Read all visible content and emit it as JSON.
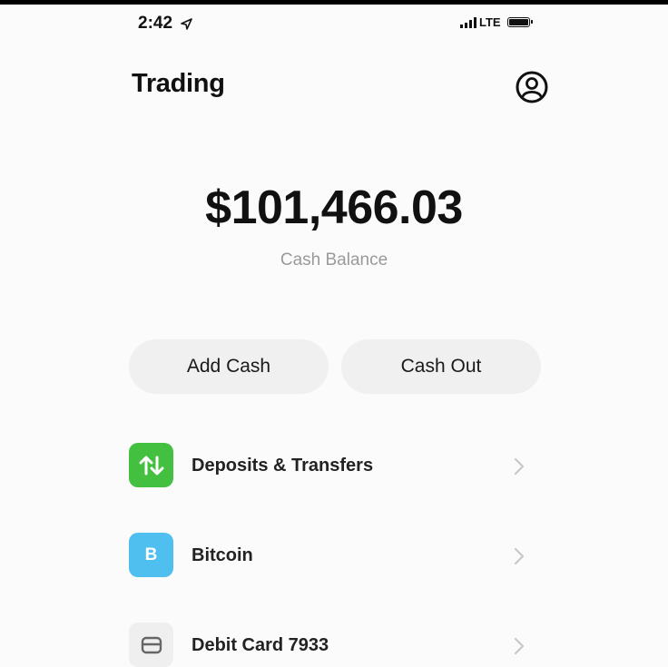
{
  "status_bar": {
    "time": "2:42",
    "network": "LTE"
  },
  "header": {
    "title": "Trading",
    "profile_icon": "profile-icon"
  },
  "balance": {
    "amount": "$101,466.03",
    "label": "Cash Balance"
  },
  "actions": {
    "add_cash_label": "Add Cash",
    "cash_out_label": "Cash Out"
  },
  "menu": {
    "items": [
      {
        "label": "Deposits & Transfers",
        "icon": "transfer-arrows-icon",
        "icon_color": "#44c040"
      },
      {
        "label": "Bitcoin",
        "icon": "bitcoin-icon",
        "icon_letter": "B",
        "icon_color": "#4fbff0"
      },
      {
        "label": "Debit Card 7933",
        "icon": "card-icon",
        "icon_color": "#efefef"
      }
    ]
  }
}
